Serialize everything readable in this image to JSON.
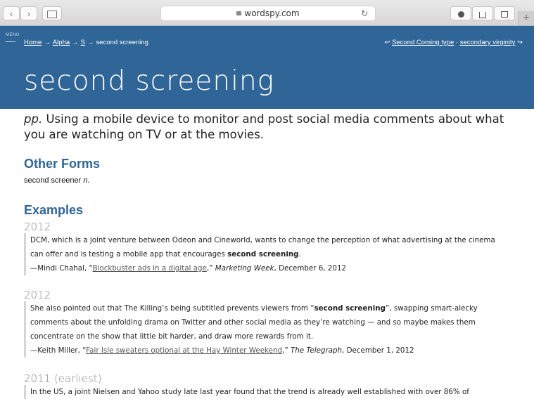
{
  "browser": {
    "url": "wordspy.com",
    "back": "‹",
    "forward": "›",
    "reload": "↻",
    "plus": "+"
  },
  "header": {
    "menu_label": "MENU",
    "breadcrumbs": [
      "Home",
      "Alpha",
      "S",
      "second screening"
    ],
    "prev_link": "Second Coming type",
    "next_link": "secondary virginity",
    "separator": "·",
    "title": "second screening"
  },
  "entry": {
    "pos": "pp.",
    "definition": " Using a mobile device to monitor and post social media comments about what you are watching on TV or at the movies.",
    "other_forms_heading": "Other Forms",
    "other_form_text": "second screener ",
    "other_form_pos": "n.",
    "examples_heading": "Examples"
  },
  "examples": [
    {
      "year": "2012",
      "pre": "DCM, which is a joint venture between Odeon and Cineworld, wants to change the perception of what advertising at the cinema can offer and is testing a mobile app that encourages ",
      "bold": "second screening",
      "post": ".",
      "cite_prefix": "—Mindi Chahal, “",
      "link": "Blockbuster ads in a digital age",
      "cite_mid": ",” ",
      "source": "Marketing Week",
      "date": ", December 6, 2012"
    },
    {
      "year": "2012",
      "pre": "She also pointed out that The Killing’s being subtitled prevents viewers from “",
      "bold": "second screening",
      "post": "”, swapping smart-alecky comments about the unfolding drama on Twitter and other social media as they’re watching — and so maybe makes them concentrate on the show that little bit harder, and draw more rewards from it.",
      "cite_prefix": "—Keith Miller, “",
      "link": "Fair Isle sweaters optional at the Hay Winter Weekend",
      "cite_mid": ",” ",
      "source": "The Telegraph",
      "date": ", December 1, 2012"
    },
    {
      "year": "2011 (earliest)",
      "pre": "In the US, a joint Nielsen and Yahoo study late last year found that the trend is already well established with over 86% of"
    }
  ]
}
